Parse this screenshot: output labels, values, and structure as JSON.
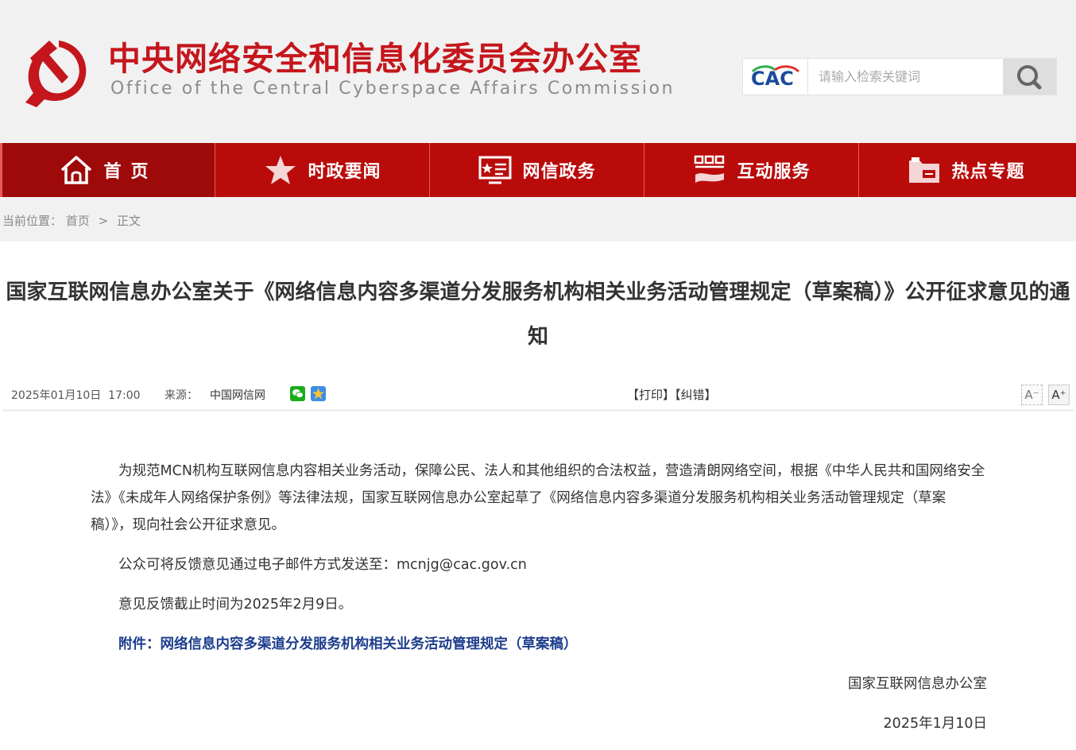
{
  "header": {
    "title_cn": "中央网络安全和信息化委员会办公室",
    "title_en": "Office of the Central Cyberspace Affairs Commission",
    "logo_icon": "hammer-sickle-emblem",
    "search": {
      "brand": "CAC",
      "placeholder": "请输入检索关键词",
      "button_icon": "search-icon"
    }
  },
  "nav": {
    "items": [
      {
        "label": "首页",
        "icon": "home-icon"
      },
      {
        "label": "时政要闻",
        "icon": "star-icon"
      },
      {
        "label": "网信政务",
        "icon": "screen-icon"
      },
      {
        "label": "互动服务",
        "icon": "handshake-icon"
      },
      {
        "label": "热点专题",
        "icon": "folder-icon"
      }
    ]
  },
  "breadcrumb": {
    "prefix": "当前位置：",
    "home": "首页",
    "sep": ">",
    "current": "正文"
  },
  "article": {
    "title": "国家互联网信息办公室关于《网络信息内容多渠道分发服务机构相关业务活动管理规定（草案稿）》公开征求意见的通知",
    "date": "2025年01月10日  17:00",
    "source_label": "来源：",
    "source": "中国网信网",
    "share": [
      "wechat-icon",
      "qzone-icon"
    ],
    "print": "【打印】",
    "correct": "【纠错】",
    "font_smaller": "A⁻",
    "font_larger": "A⁺",
    "paragraphs": [
      "为规范MCN机构互联网信息内容相关业务活动，保障公民、法人和其他组织的合法权益，营造清朗网络空间，根据《中华人民共和国网络安全法》《未成年人网络保护条例》等法律法规，国家互联网信息办公室起草了《网络信息内容多渠道分发服务机构相关业务活动管理规定（草案稿）》，现向社会公开征求意见。",
      "公众可将反馈意见通过电子邮件方式发送至：mcnjg@cac.gov.cn",
      "意见反馈截止时间为2025年2月9日。"
    ],
    "attachment": "附件：网络信息内容多渠道分发服务机构相关业务活动管理规定（草案稿）",
    "signature": "国家互联网信息办公室",
    "sign_date": "2025年1月10日"
  },
  "colors": {
    "brand_red": "#c4161c",
    "nav_red": "#ba0b0b",
    "link_blue": "#1d3d8c"
  }
}
